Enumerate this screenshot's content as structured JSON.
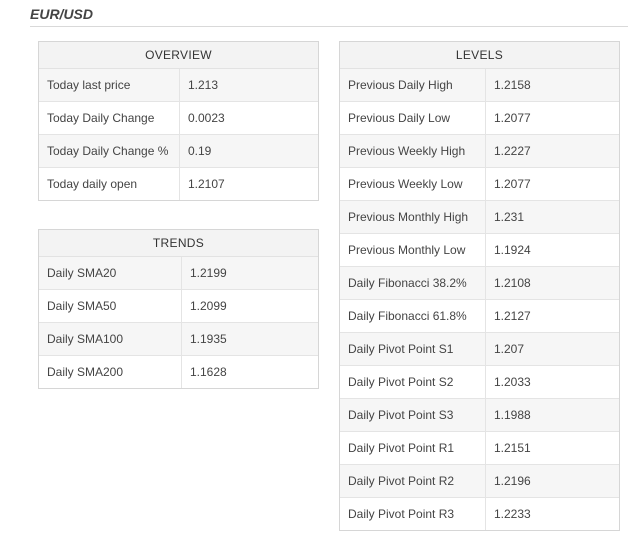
{
  "pair": "EUR/USD",
  "overview": {
    "title": "OVERVIEW",
    "rows": [
      {
        "label": "Today last price",
        "value": "1.213"
      },
      {
        "label": "Today Daily Change",
        "value": "0.0023"
      },
      {
        "label": "Today Daily Change %",
        "value": "0.19"
      },
      {
        "label": "Today daily open",
        "value": "1.2107"
      }
    ]
  },
  "trends": {
    "title": "TRENDS",
    "rows": [
      {
        "label": "Daily SMA20",
        "value": "1.2199"
      },
      {
        "label": "Daily SMA50",
        "value": "1.2099"
      },
      {
        "label": "Daily SMA100",
        "value": "1.1935"
      },
      {
        "label": "Daily SMA200",
        "value": "1.1628"
      }
    ]
  },
  "levels": {
    "title": "LEVELS",
    "rows": [
      {
        "label": "Previous Daily High",
        "value": "1.2158"
      },
      {
        "label": "Previous Daily Low",
        "value": "1.2077"
      },
      {
        "label": "Previous Weekly High",
        "value": "1.2227"
      },
      {
        "label": "Previous Weekly Low",
        "value": "1.2077"
      },
      {
        "label": "Previous Monthly High",
        "value": "1.231"
      },
      {
        "label": "Previous Monthly Low",
        "value": "1.1924"
      },
      {
        "label": "Daily Fibonacci 38.2%",
        "value": "1.2108"
      },
      {
        "label": "Daily Fibonacci 61.8%",
        "value": "1.2127"
      },
      {
        "label": "Daily Pivot Point S1",
        "value": "1.207"
      },
      {
        "label": "Daily Pivot Point S2",
        "value": "1.2033"
      },
      {
        "label": "Daily Pivot Point S3",
        "value": "1.1988"
      },
      {
        "label": "Daily Pivot Point R1",
        "value": "1.2151"
      },
      {
        "label": "Daily Pivot Point R2",
        "value": "1.2196"
      },
      {
        "label": "Daily Pivot Point R3",
        "value": "1.2233"
      }
    ]
  }
}
